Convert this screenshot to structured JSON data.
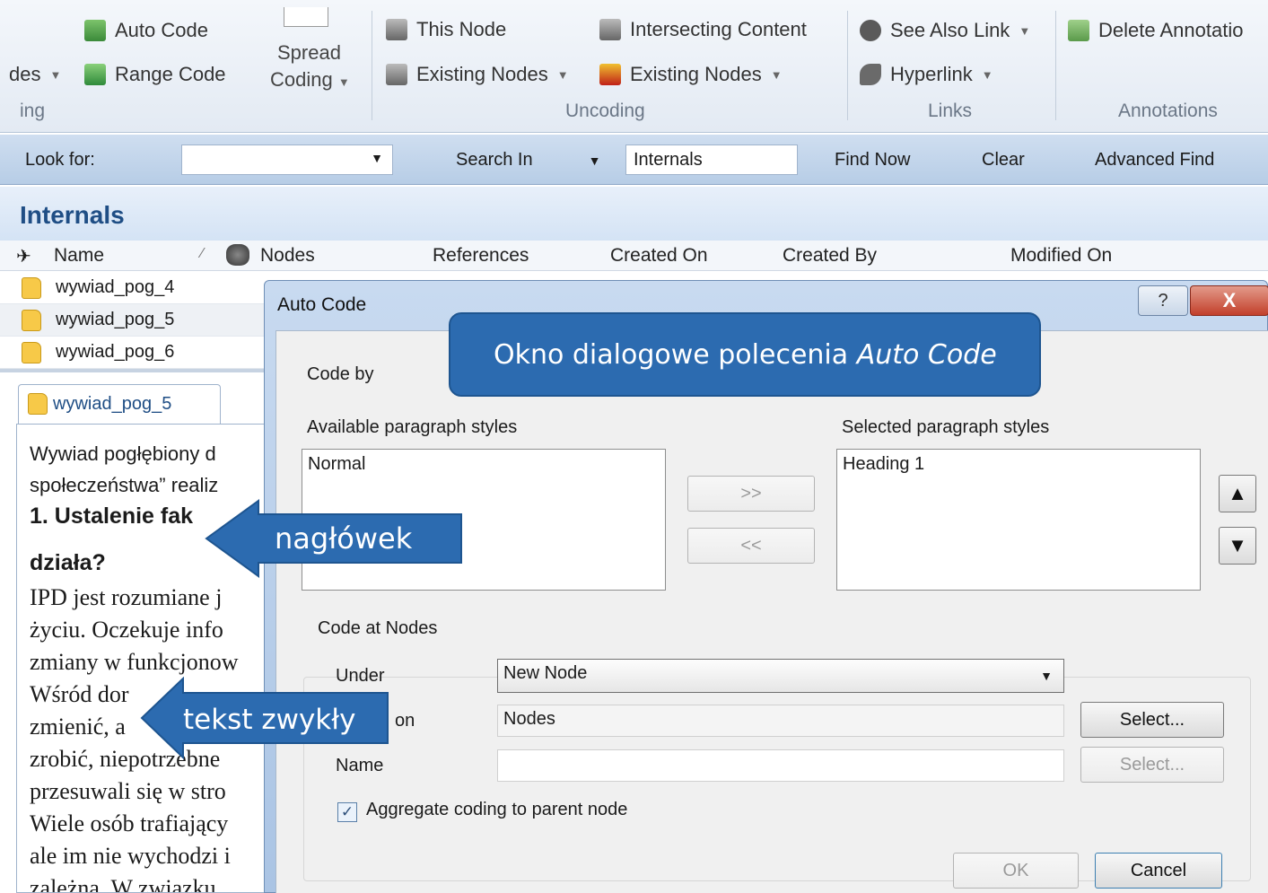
{
  "ribbon": {
    "coding_left_cut": "des",
    "auto_code": "Auto Code",
    "range_code": "Range Code",
    "spread_coding_line1": "Spread",
    "spread_coding_line2": "Coding",
    "this_node": "This Node",
    "existing_nodes_1": "Existing Nodes",
    "intersecting_content": "Intersecting Content",
    "existing_nodes_2": "Existing Nodes",
    "see_also_link": "See Also Link",
    "hyperlink": "Hyperlink",
    "delete_annotation": "Delete Annotatio",
    "group_coding_cut": "ing",
    "group_uncoding": "Uncoding",
    "group_links": "Links",
    "group_annotations": "Annotations"
  },
  "findbar": {
    "look_for": "Look for:",
    "look_for_value": "",
    "search_in": "Search In",
    "search_in_value": "Internals",
    "find_now": "Find Now",
    "clear": "Clear",
    "advanced_find": "Advanced Find"
  },
  "internals": {
    "title": "Internals",
    "columns": [
      "Name",
      "Nodes",
      "References",
      "Created On",
      "Created By",
      "Modified On"
    ],
    "rows": [
      "wywiad_pog_4",
      "wywiad_pog_5",
      "wywiad_pog_6"
    ]
  },
  "document": {
    "tab": "wywiad_pog_5",
    "lines": [
      "Wywiad pogłębiony d",
      "społeczeństwa” realiz",
      "1. Ustalenie fak",
      "działa?",
      "IPD jest rozumiane j",
      "życiu. Oczekuje info",
      "zmiany w funkcjonow",
      "Wśród dor",
      "zmienić, a",
      "zrobić, niepotrzebne",
      "przesuwali się w stro",
      "Wiele osób trafiający",
      "ale im nie wychodzi i",
      "zależna. W związku"
    ]
  },
  "dialog": {
    "title": "Auto Code",
    "help": "?",
    "close": "X",
    "code_by": "Code by",
    "available_label": "Available paragraph styles",
    "available_items": [
      "Normal"
    ],
    "selected_label": "Selected paragraph styles",
    "selected_items": [
      "Heading 1"
    ],
    "add_btn": ">>",
    "remove_btn": "<<",
    "up_btn": "▲",
    "down_btn": "▼",
    "code_at_nodes": "Code at Nodes",
    "under_label": "Under",
    "under_value": "New Node",
    "location_label": "on",
    "location_value": "Nodes",
    "select_btn_1": "Select...",
    "name_label": "Name",
    "name_value": "",
    "select_btn_2": "Select...",
    "aggregate_label": "Aggregate coding to parent node",
    "aggregate_checked": true,
    "ok": "OK",
    "cancel": "Cancel"
  },
  "callouts": {
    "main_prefix": "Okno dialogowe polecenia ",
    "main_italic": "Auto Code",
    "heading": "nagłówek",
    "normal_text": "tekst zwykły"
  },
  "colors": {
    "callout_blue": "#2c6bb0",
    "accent_blue": "#1f4e85",
    "close_red": "#c2402b"
  }
}
